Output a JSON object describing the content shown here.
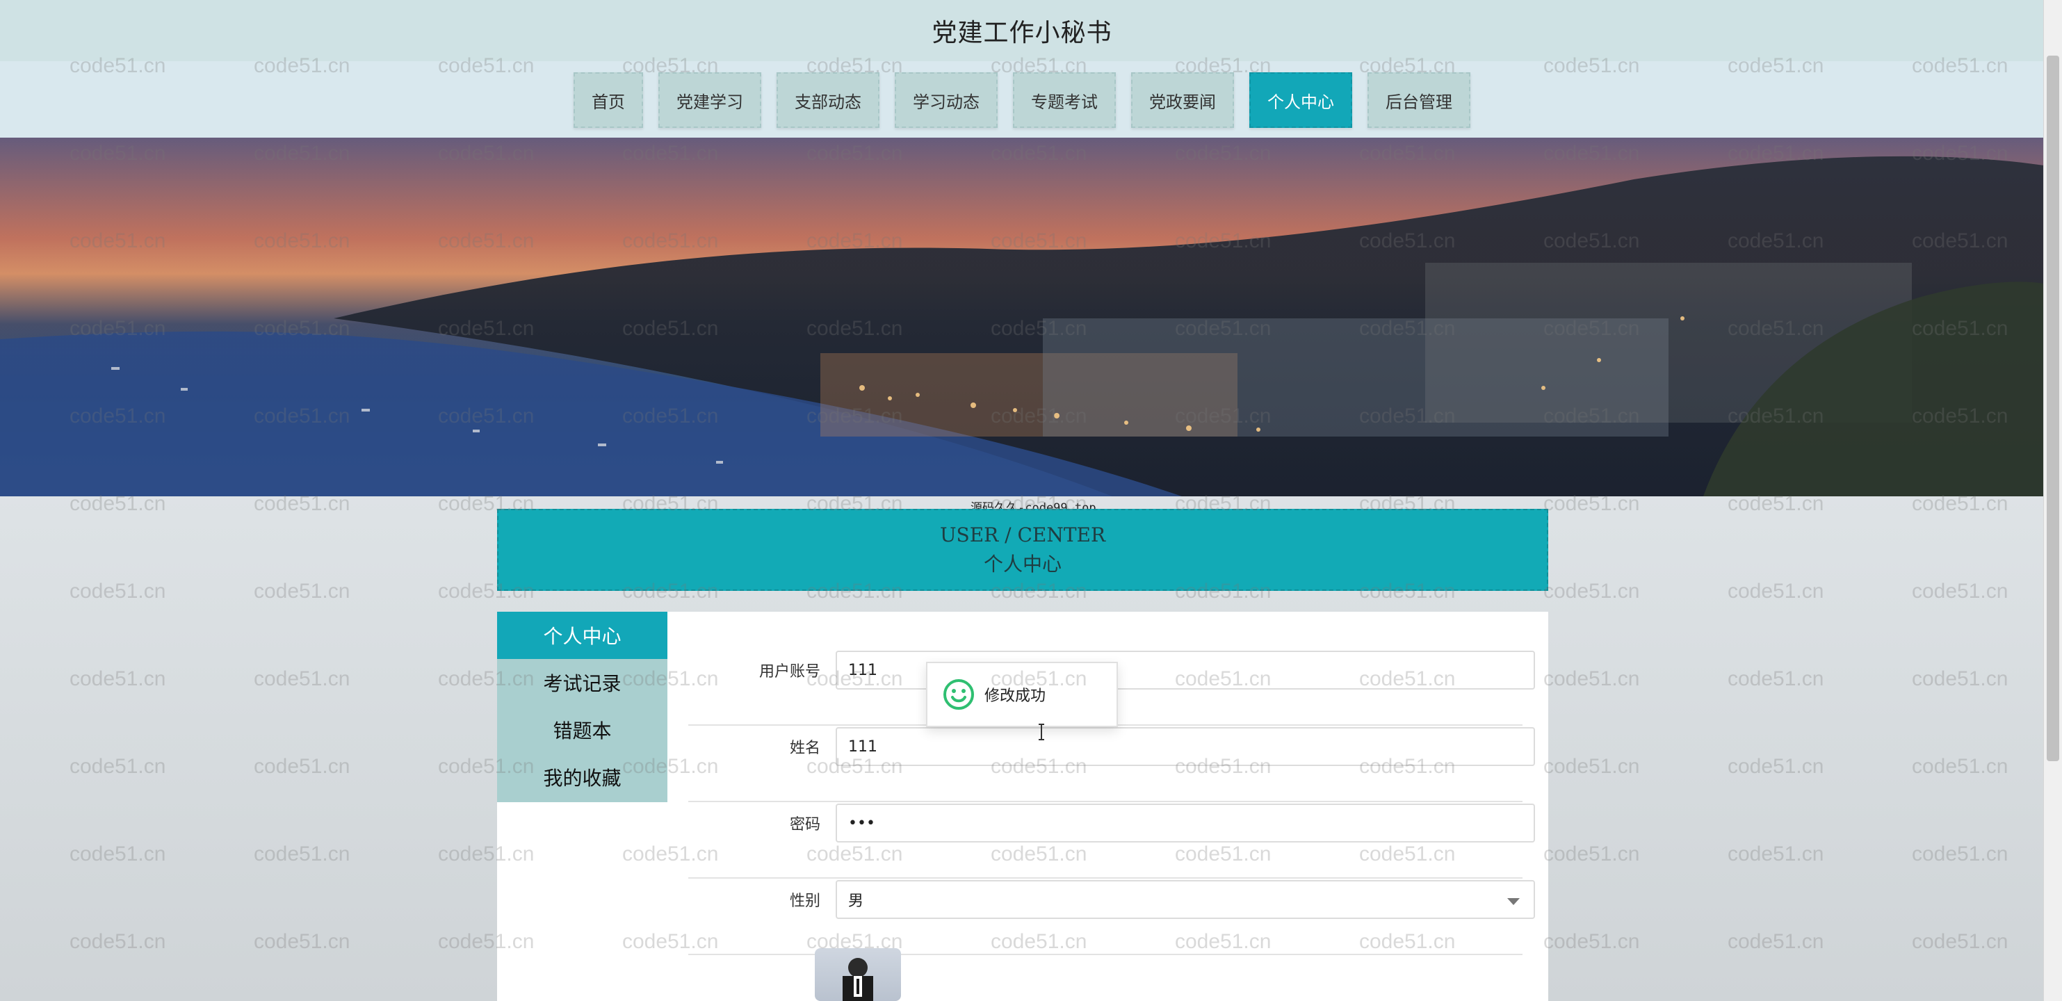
{
  "site": {
    "title": "党建工作小秘书"
  },
  "nav": {
    "items": [
      "首页",
      "党建学习",
      "支部动态",
      "学习动态",
      "专题考试",
      "党政要闻",
      "个人中心",
      "后台管理"
    ],
    "active_index": 6
  },
  "banner": {
    "source_text": "源码久久-code99.top"
  },
  "center": {
    "title_en": "USER / CENTER",
    "title_zh": "个人中心"
  },
  "side_menu": {
    "items": [
      "个人中心",
      "考试记录",
      "错题本",
      "我的收藏"
    ],
    "active_index": 0
  },
  "form": {
    "username": {
      "label": "用户账号",
      "value": "111"
    },
    "name": {
      "label": "姓名",
      "value": "111"
    },
    "password": {
      "label": "密码",
      "value": "•••"
    },
    "gender": {
      "label": "性别",
      "value": "男"
    }
  },
  "toast": {
    "text": "修改成功"
  },
  "watermark": {
    "text": "code51.cn"
  },
  "colors": {
    "accent": "#12a7b8",
    "header_bg": "#cfe2e4",
    "nav_item_bg": "#bdd6d6"
  }
}
